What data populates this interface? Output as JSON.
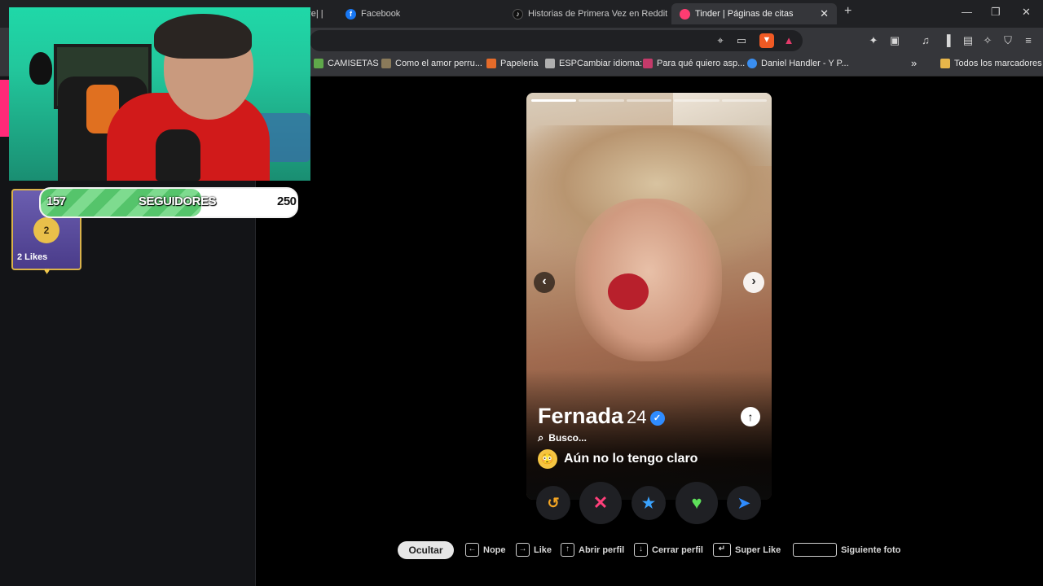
{
  "browser": {
    "tabs": [
      {
        "label": "ore| |",
        "favicon_color": "#3a3a3a",
        "icon": "generic-icon"
      },
      {
        "label": "Facebook",
        "favicon_color": "#1877f2",
        "icon": "facebook-icon"
      },
      {
        "label": "Historias de Primera Vez en Reddit |",
        "favicon_color": "#111111",
        "icon": "tiktok-icon"
      },
      {
        "label": "Tinder | Páginas de citas",
        "favicon_color": "#fe3c72",
        "icon": "tinder-icon",
        "active": true
      }
    ],
    "new_tab": "+",
    "bookmarks": [
      {
        "label": "CAMISETAS",
        "icon": "shopify-icon",
        "color": "#5fa84a"
      },
      {
        "label": "Como el amor perru...",
        "icon": "bookmark-icon",
        "color": "#8a7a5a"
      },
      {
        "label": "Papeleria",
        "icon": "bookmark-icon",
        "color": "#e56b2a"
      },
      {
        "label": "ESPCambiar idioma:",
        "icon": "bookmark-icon",
        "color": "#b0b0b0"
      },
      {
        "label": "Para qué quiero asp...",
        "icon": "bookmark-icon",
        "color": "#c43a6a"
      },
      {
        "label": "Daniel Handler - Y P...",
        "icon": "cloud-icon",
        "color": "#3a8ef0"
      }
    ],
    "more_bookmarks": "»",
    "all_bookmarks": "Todos los marcadores"
  },
  "stream": {
    "followers": {
      "current": "157",
      "label": "SEGUIDORES",
      "goal": "250",
      "progress": 0.628
    },
    "likes_badge": {
      "count": "2",
      "label": "2 Likes"
    }
  },
  "profile": {
    "name": "Fernada",
    "age": "24",
    "looking_for_label": "Busco...",
    "intent": "Aún no lo tengo claro",
    "intent_emoji": "😳",
    "photo_count": 5,
    "active_photo": 0
  },
  "actions": {
    "rewind": {
      "icon": "rewind-icon",
      "color": "#f5a623",
      "glyph": "↺"
    },
    "nope": {
      "icon": "nope-icon",
      "color": "#ff3f7a",
      "glyph": "✕"
    },
    "superlike": {
      "icon": "star-icon",
      "color": "#3aa3ff",
      "glyph": "★"
    },
    "like": {
      "icon": "heart-icon",
      "color": "#5ee05a",
      "glyph": "♥"
    },
    "boost": {
      "icon": "send-icon",
      "color": "#2f8cff",
      "glyph": "➤"
    }
  },
  "shortcuts": {
    "hide": "Ocultar",
    "items": [
      {
        "key": "←",
        "label": "Nope"
      },
      {
        "key": "→",
        "label": "Like"
      },
      {
        "key": "↑",
        "label": "Abrir perfil"
      },
      {
        "key": "↓",
        "label": "Cerrar perfil"
      },
      {
        "key": "↵",
        "label": "Super Like"
      },
      {
        "key": "",
        "label": "Siguiente foto"
      }
    ]
  }
}
